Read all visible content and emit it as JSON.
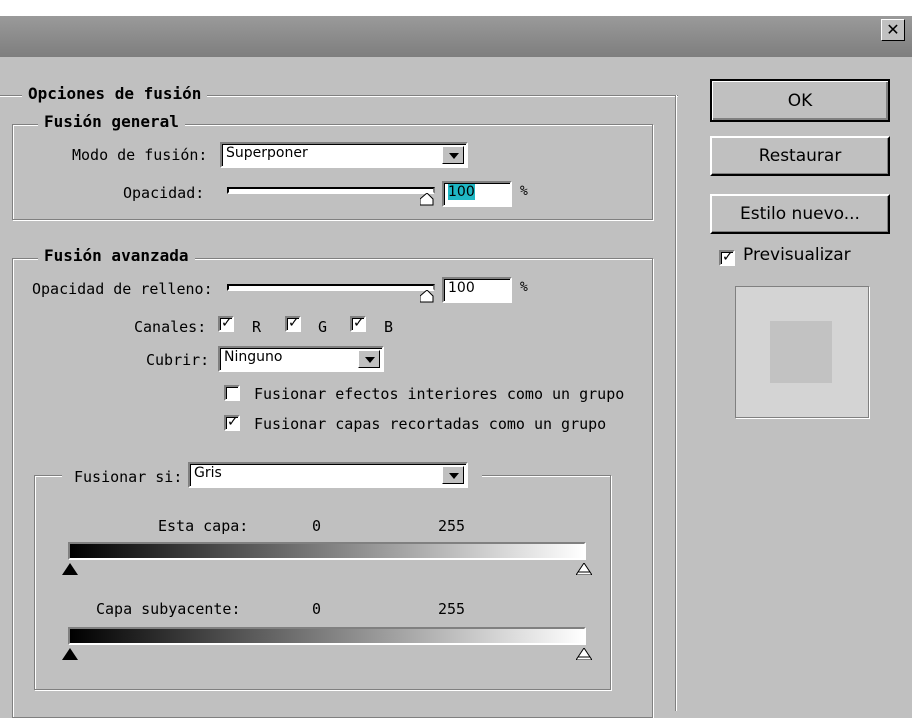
{
  "dialog": {
    "close_icon": "close-icon",
    "close_glyph": "✕"
  },
  "blending_options": {
    "title": "Opciones de fusión",
    "general": {
      "title": "Fusión general",
      "mode_label": "Modo de fusión:",
      "mode_value": "Superponer",
      "opacity_label": "Opacidad:",
      "opacity_value": "100",
      "percent": "%"
    },
    "advanced": {
      "title": "Fusión avanzada",
      "fill_opacity_label": "Opacidad de relleno:",
      "fill_opacity_value": "100",
      "percent": "%",
      "channels_label": "Canales:",
      "channels": [
        {
          "name": "R",
          "checked": true
        },
        {
          "name": "G",
          "checked": true
        },
        {
          "name": "B",
          "checked": true
        }
      ],
      "knockout_label": "Cubrir:",
      "knockout_value": "Ninguno",
      "blend_interior_label": "Fusionar efectos interiores como un grupo",
      "blend_interior_checked": false,
      "blend_clipped_label": "Fusionar capas recortadas como un grupo",
      "blend_clipped_checked": true
    },
    "blend_if": {
      "label": "Fusionar si:",
      "value": "Gris",
      "this_layer": {
        "label": "Esta capa:",
        "min": "0",
        "max": "255"
      },
      "underlying": {
        "label": "Capa subyacente:",
        "min": "0",
        "max": "255"
      }
    }
  },
  "buttons": {
    "ok": "OK",
    "reset": "Restaurar",
    "new_style": "Estilo nuevo...",
    "preview_label": "Previsualizar",
    "preview_checked": true
  },
  "checkmark": "✓"
}
